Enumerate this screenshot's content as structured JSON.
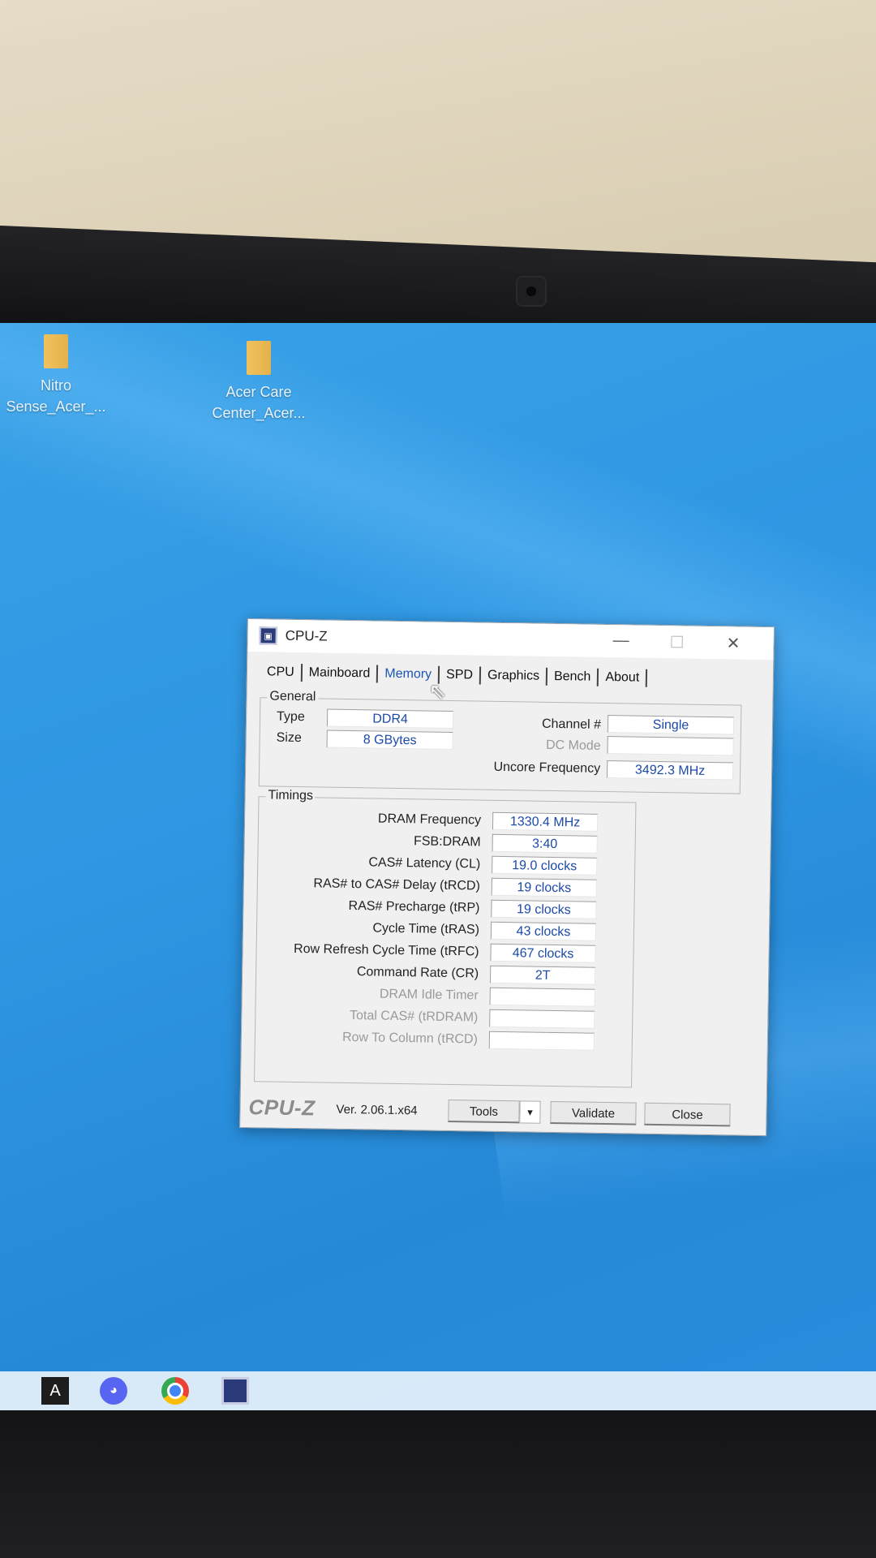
{
  "desktop": {
    "icons": [
      {
        "label_line1": "Nitro",
        "label_line2": "Sense_Acer_..."
      },
      {
        "label_line1": "Acer Care",
        "label_line2": "Center_Acer..."
      }
    ]
  },
  "window": {
    "title": "CPU-Z",
    "minimize": "—",
    "maximize": "☐",
    "close": "✕",
    "tabs": [
      "CPU",
      "Mainboard",
      "Memory",
      "SPD",
      "Graphics",
      "Bench",
      "About"
    ],
    "active_tab": "Memory",
    "general": {
      "group_label": "General",
      "type_label": "Type",
      "type_value": "DDR4",
      "size_label": "Size",
      "size_value": "8 GBytes",
      "channel_label": "Channel #",
      "channel_value": "Single",
      "dcmode_label": "DC Mode",
      "dcmode_value": "",
      "uncore_label": "Uncore Frequency",
      "uncore_value": "3492.3 MHz"
    },
    "timings": {
      "group_label": "Timings",
      "rows": [
        {
          "label": "DRAM Frequency",
          "value": "1330.4 MHz",
          "disabled": false
        },
        {
          "label": "FSB:DRAM",
          "value": "3:40",
          "disabled": false
        },
        {
          "label": "CAS# Latency (CL)",
          "value": "19.0 clocks",
          "disabled": false
        },
        {
          "label": "RAS# to CAS# Delay (tRCD)",
          "value": "19 clocks",
          "disabled": false
        },
        {
          "label": "RAS# Precharge (tRP)",
          "value": "19 clocks",
          "disabled": false
        },
        {
          "label": "Cycle Time (tRAS)",
          "value": "43 clocks",
          "disabled": false
        },
        {
          "label": "Row Refresh Cycle Time (tRFC)",
          "value": "467 clocks",
          "disabled": false
        },
        {
          "label": "Command Rate (CR)",
          "value": "2T",
          "disabled": false
        },
        {
          "label": "DRAM Idle Timer",
          "value": "",
          "disabled": true
        },
        {
          "label": "Total CAS# (tRDRAM)",
          "value": "",
          "disabled": true
        },
        {
          "label": "Row To Column (tRCD)",
          "value": "",
          "disabled": true
        }
      ]
    },
    "footer": {
      "brand": "CPU-Z",
      "version": "Ver. 2.06.1.x64",
      "tools_label": "Tools",
      "validate_label": "Validate",
      "close_label": "Close"
    }
  },
  "taskbar": {
    "icons": [
      "assassins-creed-icon",
      "discord-icon",
      "chrome-icon",
      "cpuz-icon"
    ]
  },
  "colors": {
    "value_text": "#1c4aa8",
    "active_tab": "#1b54b8",
    "desktop": "#2f97e3"
  }
}
